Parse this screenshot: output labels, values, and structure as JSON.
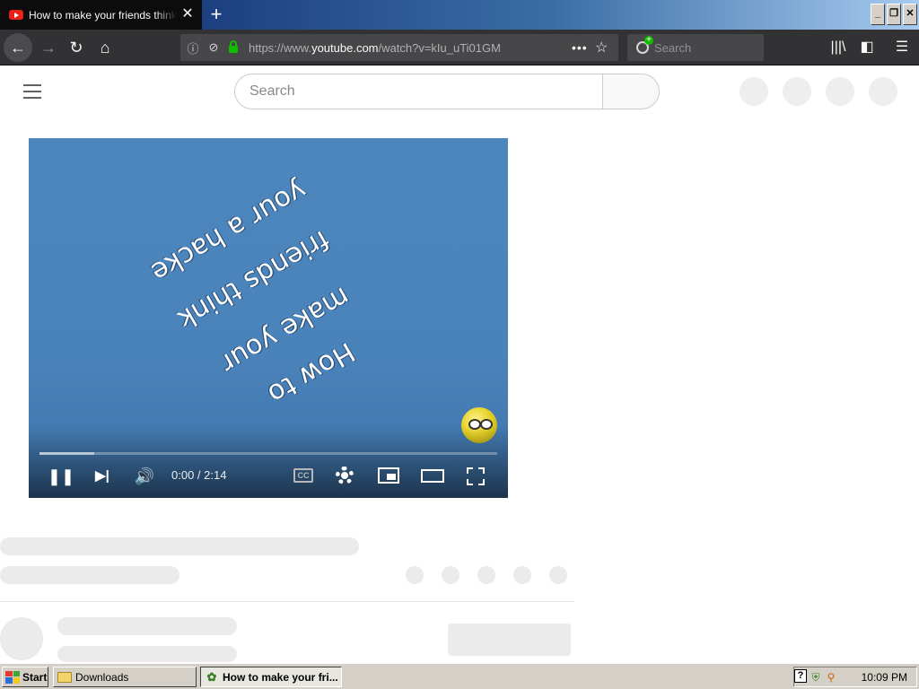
{
  "browser": {
    "tab": {
      "title": "How to make your friends think your a hacker - YouTube",
      "close_symbol": "✕",
      "favicon": "youtube-favicon-icon"
    },
    "new_tab_symbol": "+",
    "window_controls": [
      "_",
      "❐",
      "✕"
    ],
    "nav": {
      "back": "←",
      "forward": "→",
      "reload": "↻",
      "home": "⌂"
    },
    "url": {
      "prefix": "https://www.",
      "domain": "youtube.com",
      "path": "/watch?v=kIu_uTi01GM"
    },
    "more_symbol": "•••",
    "bookmark_symbol": "☆",
    "search_placeholder": "Search",
    "toolbar_icons": {
      "library": "|||\\",
      "sidebar": "◧",
      "menu": "☰"
    }
  },
  "youtube": {
    "search_placeholder": "Search",
    "video": {
      "overlay_text": [
        "How to",
        "make your",
        "friends think",
        "your a hacke"
      ],
      "current_time": "0:00",
      "duration": "2:14",
      "time_display": "0:00 / 2:14",
      "buffered_fraction": 0.12,
      "cc_label": "CC",
      "controls": {
        "pause": "❚❚",
        "next": "▶|",
        "volume": "🔊"
      }
    }
  },
  "taskbar": {
    "start_label": "Start",
    "tasks": [
      {
        "label": "Downloads"
      },
      {
        "label": "How to make your fri..."
      }
    ],
    "clock": "10:09 PM",
    "help_symbol": "?"
  },
  "colors": {
    "tab_active": "#0c0c0d",
    "toolbar": "#323234",
    "video_bg": "#4d86bd",
    "skeleton": "#ebebeb",
    "taskbar": "#d4d0c8"
  }
}
